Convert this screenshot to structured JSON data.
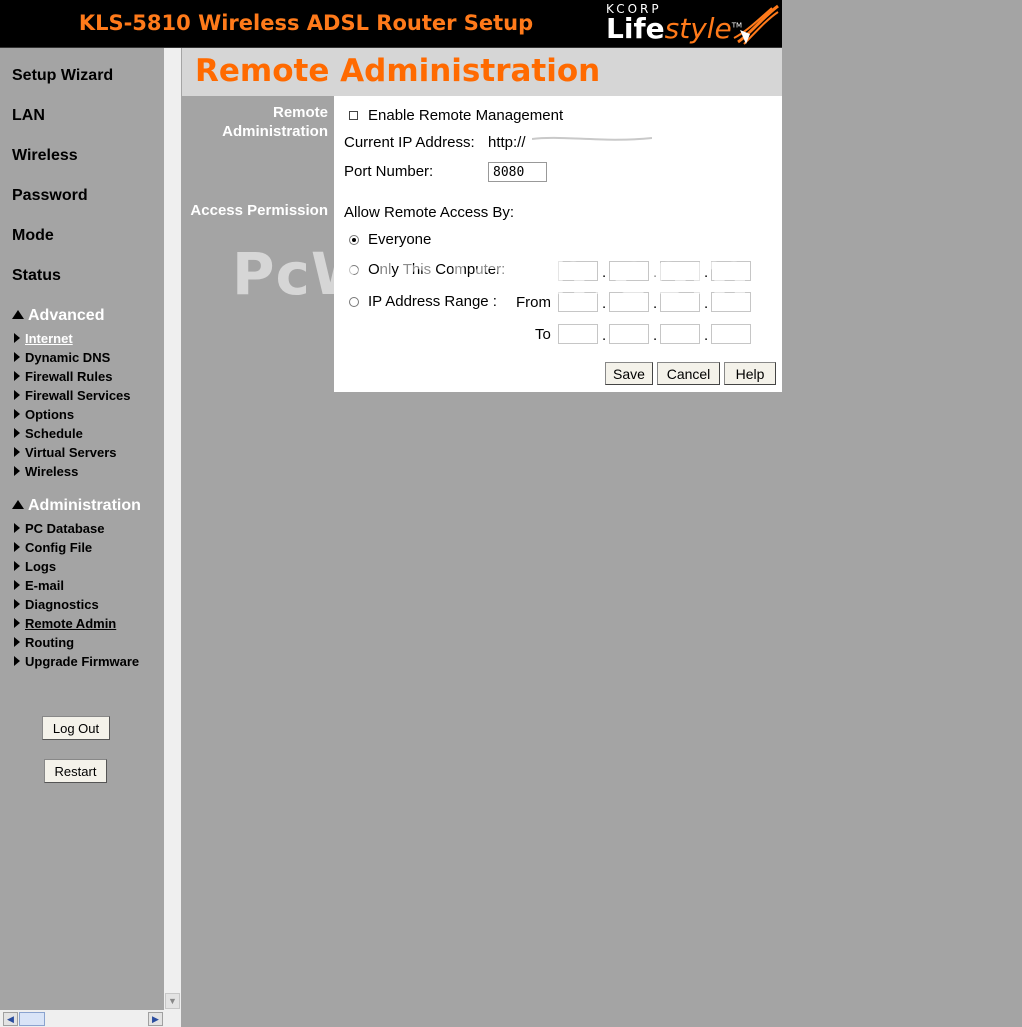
{
  "header": {
    "title": "KLS-5810 Wireless ADSL Router Setup",
    "logo_top": "KCORP",
    "logo_life": "Life",
    "logo_style": "style",
    "logo_tm": "TM"
  },
  "sidebar": {
    "main_items": [
      "Setup Wizard",
      "LAN",
      "Wireless",
      "Password",
      "Mode",
      "Status"
    ],
    "advanced_heading": "Advanced",
    "advanced_items": [
      "Internet",
      "Dynamic DNS",
      "Firewall Rules",
      "Firewall Services",
      "Options",
      "Schedule",
      "Virtual Servers",
      "Wireless"
    ],
    "admin_heading": "Administration",
    "admin_items": [
      "PC Database",
      "Config File",
      "Logs",
      "E-mail",
      "Diagnostics",
      "Remote Admin",
      "Routing",
      "Upgrade Firmware"
    ],
    "logout_label": "Log Out",
    "restart_label": "Restart"
  },
  "main": {
    "title": "Remote Administration",
    "section1_label": "Remote Administration",
    "enable_label": "Enable Remote Management",
    "enable_checked": false,
    "current_ip_label": "Current IP Address:",
    "current_ip_value": "http://",
    "port_label": "Port Number:",
    "port_value": "8080",
    "section2_label": "Access Permission",
    "allow_label": "Allow Remote Access By:",
    "everyone_label": "Everyone",
    "only_this_label": "Only This Computer:",
    "ip_range_label": "IP Address Range :",
    "from_label": "From",
    "to_label": "To",
    "selected_option": "Everyone",
    "ip_dot": ".",
    "save_label": "Save",
    "cancel_label": "Cancel",
    "help_label": "Help"
  },
  "watermark": "PcWinTech.com",
  "colors": {
    "accent_orange": "#ff6a00",
    "frame_gray": "#a4a4a4",
    "header_black": "#000000"
  }
}
